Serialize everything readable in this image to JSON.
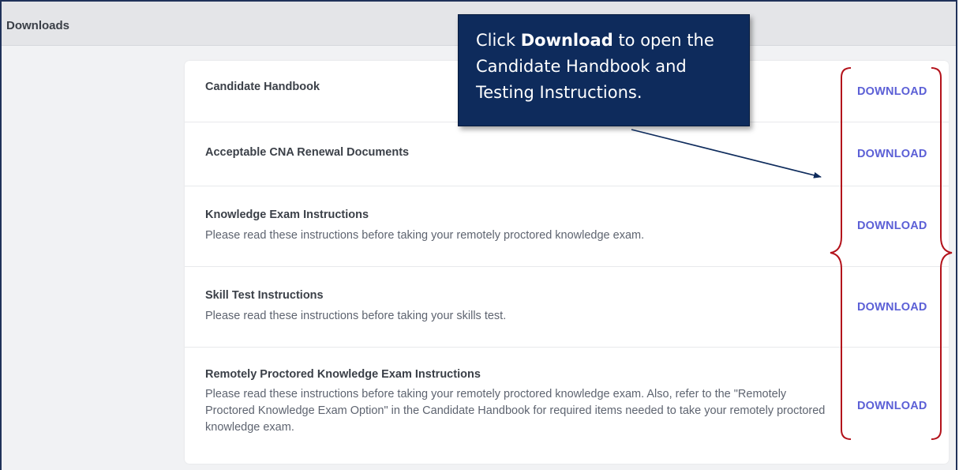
{
  "panel": {
    "title": "Downloads"
  },
  "callout": {
    "prefix": "Click ",
    "bold": "Download",
    "suffix": " to open the Candidate Handbook and Testing Instructions."
  },
  "downloads": [
    {
      "title": "Candidate Handbook",
      "description": "",
      "action": "DOWNLOAD"
    },
    {
      "title": "Acceptable CNA Renewal Documents",
      "description": "",
      "action": "DOWNLOAD"
    },
    {
      "title": "Knowledge Exam Instructions",
      "description": "Please read these instructions before taking your remotely proctored knowledge exam.",
      "action": "DOWNLOAD"
    },
    {
      "title": "Skill Test Instructions",
      "description": "Please read these instructions before taking your skills test.",
      "action": "DOWNLOAD"
    },
    {
      "title": "Remotely Proctored Knowledge Exam Instructions",
      "description": "Please read these instructions before taking your remotely proctored knowledge exam. Also, refer to the \"Remotely Proctored Knowledge Exam Option\" in the Candidate Handbook for required items needed to take your remotely proctored knowledge exam.",
      "action": "DOWNLOAD"
    }
  ],
  "colors": {
    "callout_bg": "#0e2b5c",
    "bracket": "#b3121b",
    "download_link": "#5b5fd6"
  }
}
